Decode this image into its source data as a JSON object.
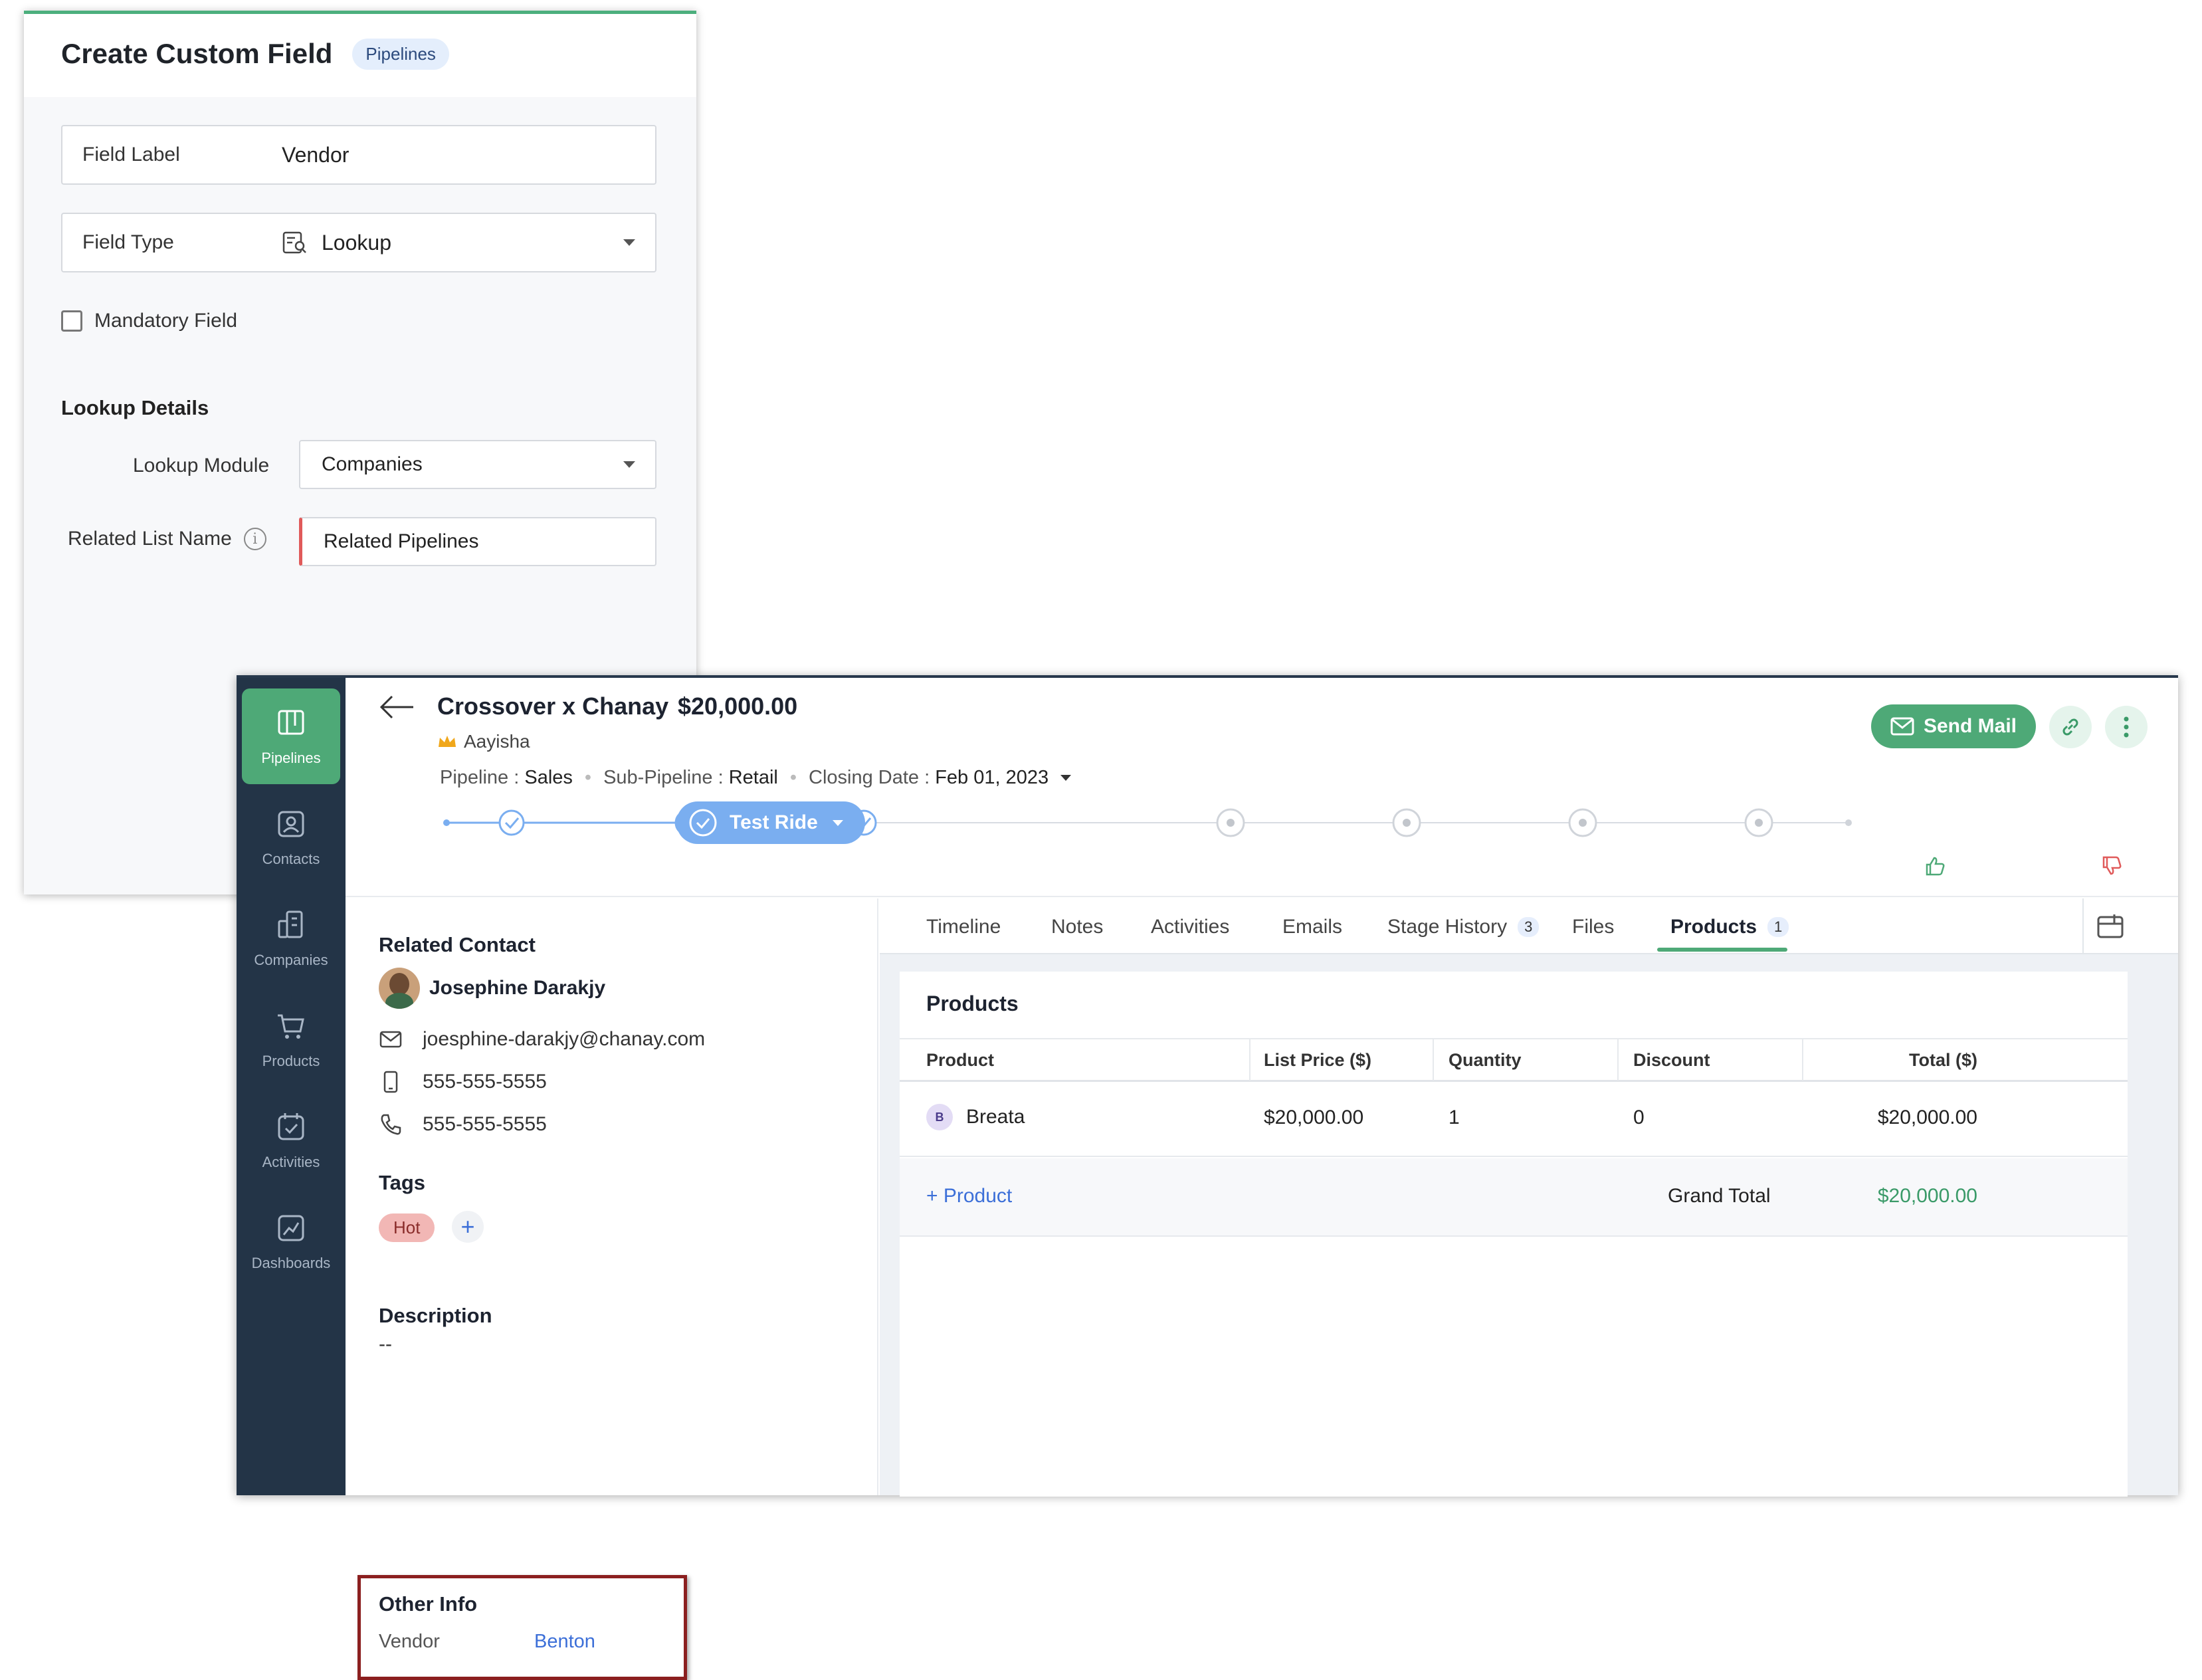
{
  "create_field": {
    "title": "Create Custom Field",
    "badge": "Pipelines",
    "field_label": {
      "label": "Field Label",
      "value": "Vendor"
    },
    "field_type": {
      "label": "Field Type",
      "value": "Lookup"
    },
    "mandatory_label": "Mandatory Field",
    "mandatory_checked": false,
    "section": "Lookup Details",
    "lookup_module": {
      "label": "Lookup Module",
      "value": "Companies"
    },
    "related_list": {
      "label": "Related List Name",
      "value": "Related Pipelines"
    }
  },
  "sidebar": {
    "items": [
      {
        "label": "Pipelines",
        "icon": "pipelines-icon",
        "active": true
      },
      {
        "label": "Contacts",
        "icon": "contacts-icon",
        "active": false
      },
      {
        "label": "Companies",
        "icon": "companies-icon",
        "active": false
      },
      {
        "label": "Products",
        "icon": "products-icon",
        "active": false
      },
      {
        "label": "Activities",
        "icon": "activities-icon",
        "active": false
      },
      {
        "label": "Dashboards",
        "icon": "dashboards-icon",
        "active": false
      }
    ]
  },
  "deal": {
    "name": "Crossover x Chanay",
    "amount": "$20,000.00",
    "owner": "Aayisha",
    "pipeline_label": "Pipeline",
    "pipeline_value": "Sales",
    "subpipeline_label": "Sub-Pipeline",
    "subpipeline_value": "Retail",
    "closing_label": "Closing Date",
    "closing_value": "Feb 01, 2023",
    "current_stage": "Test Ride",
    "send_mail": "Send Mail"
  },
  "contact": {
    "section": "Related Contact",
    "name": "Josephine Darakjy",
    "email": "joesphine-darakjy@chanay.com",
    "mobile": "555-555-5555",
    "phone": "555-555-5555"
  },
  "tags": {
    "section": "Tags",
    "items": [
      "Hot"
    ]
  },
  "description": {
    "section": "Description",
    "value": "--"
  },
  "other_info": {
    "section": "Other Info",
    "label": "Vendor",
    "value": "Benton"
  },
  "tabs": [
    {
      "label": "Timeline"
    },
    {
      "label": "Notes"
    },
    {
      "label": "Activities"
    },
    {
      "label": "Emails"
    },
    {
      "label": "Stage History",
      "count": "3"
    },
    {
      "label": "Files"
    },
    {
      "label": "Products",
      "count": "1",
      "active": true
    }
  ],
  "products": {
    "title": "Products",
    "columns": [
      "Product",
      "List Price ($)",
      "Quantity",
      "Discount",
      "Total ($)"
    ],
    "rows": [
      {
        "initial": "B",
        "product": "Breata",
        "list_price": "$20,000.00",
        "quantity": "1",
        "discount": "0",
        "total": "$20,000.00"
      }
    ],
    "add_label": "+ Product",
    "grand_total_label": "Grand Total",
    "grand_total_value": "$20,000.00"
  },
  "colors": {
    "accent": "#4ea977",
    "sidebar": "#233447",
    "stage_blue": "#7aaef0",
    "highlight_border": "#8b1f1f"
  }
}
